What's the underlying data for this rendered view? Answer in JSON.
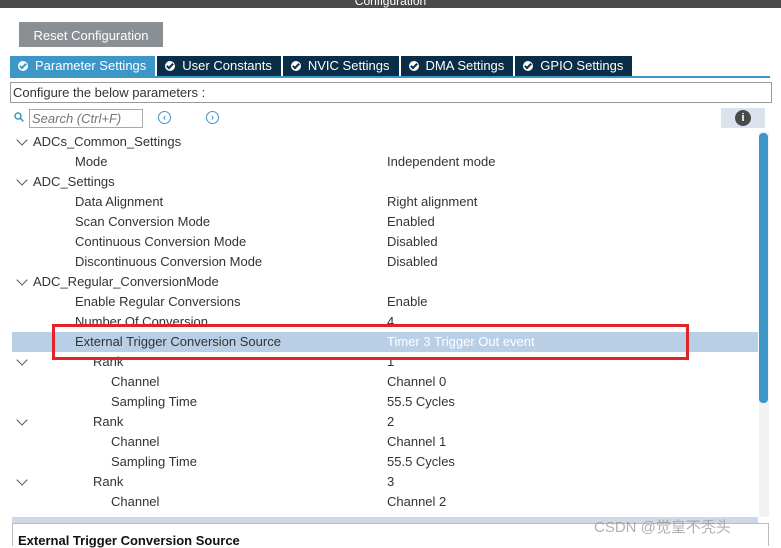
{
  "window": {
    "title": "Configuration"
  },
  "toolbar": {
    "reset_label": "Reset Configuration"
  },
  "tabs": [
    {
      "label": "Parameter Settings",
      "active": true
    },
    {
      "label": "User Constants",
      "active": false
    },
    {
      "label": "NVIC Settings",
      "active": false
    },
    {
      "label": "DMA Settings",
      "active": false
    },
    {
      "label": "GPIO Settings",
      "active": false
    }
  ],
  "config_hint": "Configure the below parameters :",
  "search": {
    "placeholder": "Search (Ctrl+F)",
    "prev_icon": "chevron-left-icon",
    "next_icon": "chevron-right-icon"
  },
  "info": {
    "glyph": "i"
  },
  "tree": [
    {
      "label": "ADCs_Common_Settings",
      "value": "",
      "expanded": true
    },
    {
      "label": "Mode",
      "value": "Independent mode"
    },
    {
      "label": "ADC_Settings",
      "value": "",
      "expanded": true
    },
    {
      "label": "Data Alignment",
      "value": "Right alignment"
    },
    {
      "label": "Scan Conversion Mode",
      "value": "Enabled"
    },
    {
      "label": "Continuous Conversion Mode",
      "value": "Disabled"
    },
    {
      "label": "Discontinuous Conversion Mode",
      "value": "Disabled"
    },
    {
      "label": "ADC_Regular_ConversionMode",
      "value": "",
      "expanded": true
    },
    {
      "label": "Enable Regular Conversions",
      "value": "Enable"
    },
    {
      "label": "Number Of Conversion",
      "value": "4"
    },
    {
      "label": "External Trigger Conversion Source",
      "value": "Timer 3 Trigger Out event",
      "selected": true
    },
    {
      "label": "Rank",
      "value": "1",
      "expanded": true
    },
    {
      "label": "Channel",
      "value": "Channel 0"
    },
    {
      "label": "Sampling Time",
      "value": "55.5 Cycles"
    },
    {
      "label": "Rank",
      "value": "2",
      "expanded": true
    },
    {
      "label": "Channel",
      "value": "Channel 1"
    },
    {
      "label": "Sampling Time",
      "value": "55.5 Cycles"
    },
    {
      "label": "Rank",
      "value": "3",
      "expanded": true
    },
    {
      "label": "Channel",
      "value": "Channel 2"
    }
  ],
  "description": {
    "title": "External Trigger Conversion Source"
  },
  "watermark": "CSDN @觉皇不秃头",
  "colors": {
    "active_tab": "#3d96c8",
    "tab": "#0a2e47",
    "selected_row": "#b9cfe6",
    "highlight": "#e2232a"
  }
}
